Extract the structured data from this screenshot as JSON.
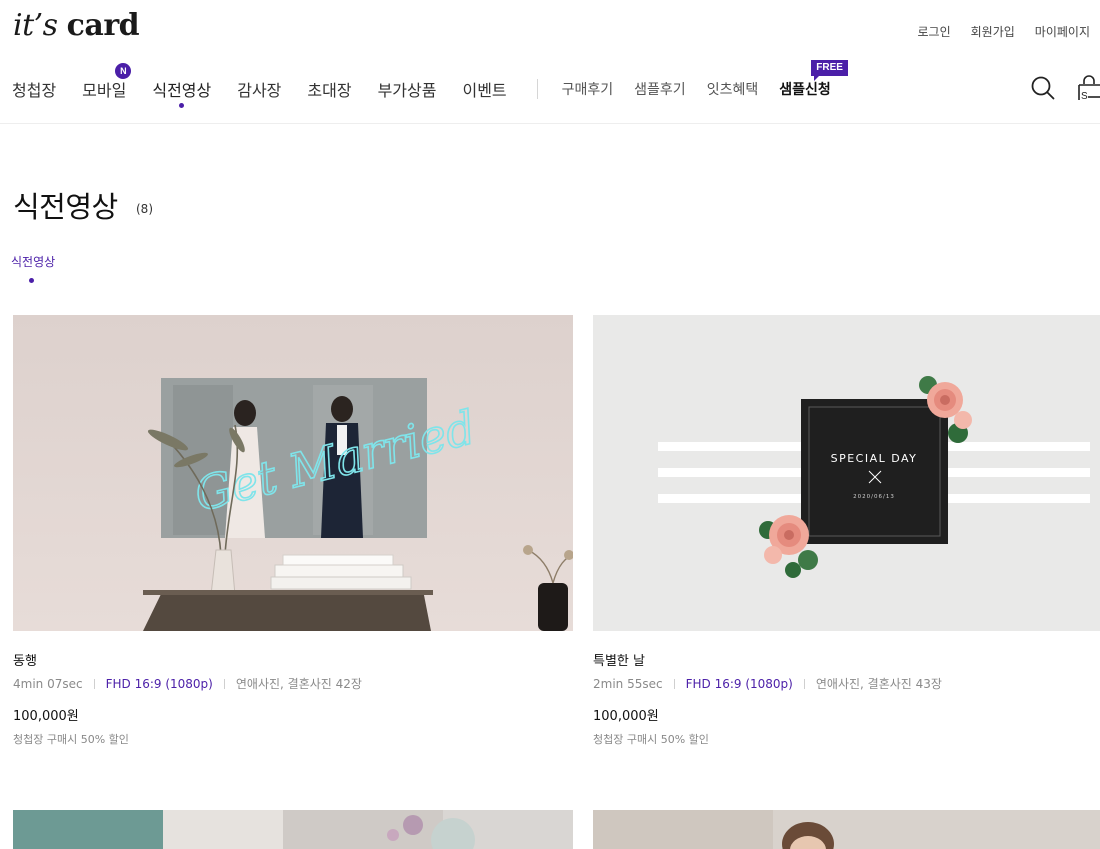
{
  "brand": {
    "logo_italic": "it’s",
    "logo_bold": "card"
  },
  "util_links": [
    "로그인",
    "회원가입",
    "마이페이지"
  ],
  "gnb": {
    "main": [
      {
        "label": "청첩장"
      },
      {
        "label": "모바일",
        "badge": "N"
      },
      {
        "label": "식전영상",
        "active": true
      },
      {
        "label": "감사장"
      },
      {
        "label": "초대장"
      },
      {
        "label": "부가상품"
      },
      {
        "label": "이벤트"
      }
    ],
    "sub": [
      {
        "label": "구매후기"
      },
      {
        "label": "샘플후기"
      },
      {
        "label": "잇츠혜택"
      },
      {
        "label": "샘플신청",
        "badge": "FREE"
      }
    ]
  },
  "page": {
    "title": "식전영상",
    "count": "(8)"
  },
  "subtabs": [
    {
      "label": "식전영상",
      "active": true
    }
  ],
  "products": [
    {
      "name": "동행",
      "duration": "4min 07sec",
      "resolution": "FHD 16:9 (1080p)",
      "photos": "연애사진, 결혼사진 42장",
      "price": "100,000원",
      "discount": "청첩장 구매시 50% 할인",
      "thumb_text": "Get Married"
    },
    {
      "name": "특별한 날",
      "duration": "2min 55sec",
      "resolution": "FHD 16:9 (1080p)",
      "photos": "연애사진, 결혼사진 43장",
      "price": "100,000원",
      "discount": "청첩장 구매시 50% 할인",
      "thumb_text": "SPECIAL DAY",
      "thumb_date": "2020/06/13"
    }
  ],
  "colors": {
    "accent": "#4b1fa8",
    "text": "#222222",
    "muted": "#8a8a8a"
  }
}
